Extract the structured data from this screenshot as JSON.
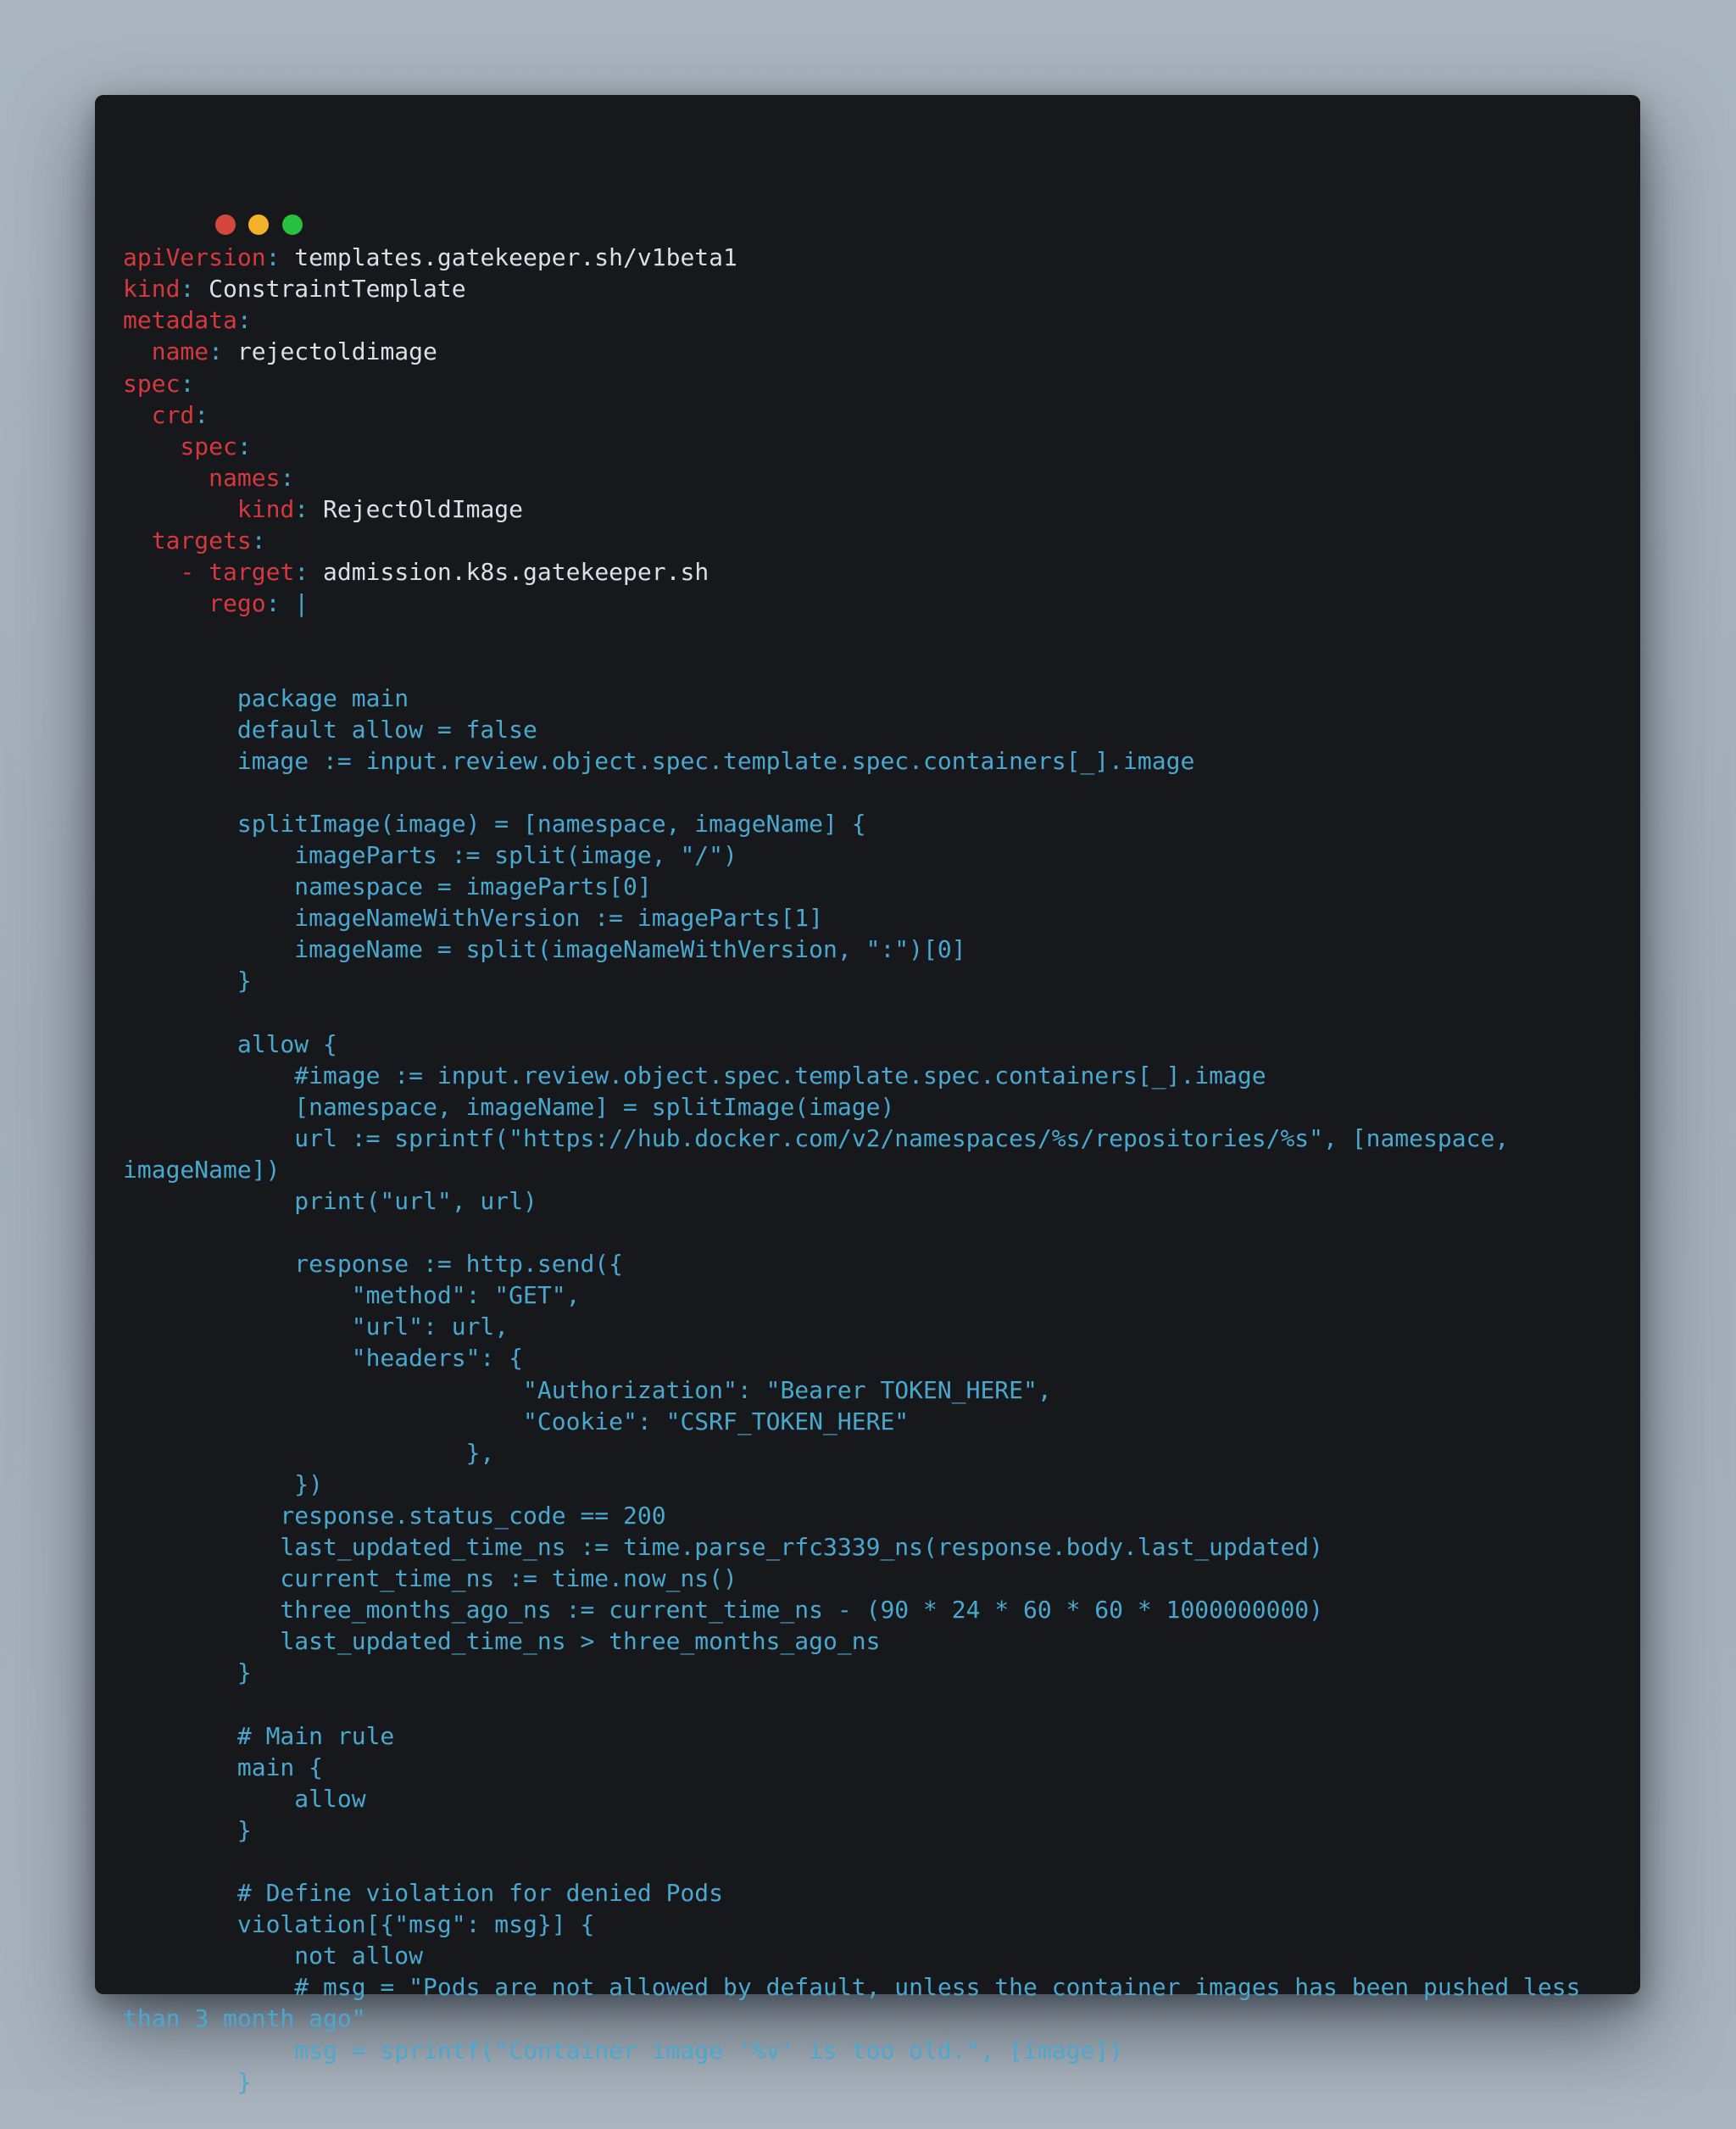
{
  "window": {
    "controls": [
      "close",
      "minimize",
      "maximize"
    ],
    "colors": {
      "close": "#d4473d",
      "minimize": "#f4b12a",
      "maximize": "#27c13f",
      "background": "#17181b",
      "key": "#d5393f",
      "value": "#dcdfe3",
      "code": "#4aa8cf"
    }
  },
  "yaml": [
    {
      "indent": "",
      "key": "apiVersion",
      "value": "templates.gatekeeper.sh/v1beta1"
    },
    {
      "indent": "",
      "key": "kind",
      "value": "ConstraintTemplate"
    },
    {
      "indent": "",
      "key": "metadata",
      "value": ""
    },
    {
      "indent": "  ",
      "key": "name",
      "value": "rejectoldimage"
    },
    {
      "indent": "",
      "key": "spec",
      "value": ""
    },
    {
      "indent": "  ",
      "key": "crd",
      "value": ""
    },
    {
      "indent": "    ",
      "key": "spec",
      "value": ""
    },
    {
      "indent": "      ",
      "key": "names",
      "value": ""
    },
    {
      "indent": "        ",
      "key": "kind",
      "value": "RejectOldImage"
    },
    {
      "indent": "  ",
      "key": "targets",
      "value": ""
    },
    {
      "indent": "    - ",
      "key": "target",
      "value": "admission.k8s.gatekeeper.sh"
    },
    {
      "indent": "      ",
      "key": "rego",
      "value": "|"
    }
  ],
  "rego": [
    "        package main",
    "        default allow = false",
    "        image := input.review.object.spec.template.spec.containers[_].image",
    "",
    "        splitImage(image) = [namespace, imageName] {",
    "            imageParts := split(image, \"/\")",
    "            namespace = imageParts[0]",
    "            imageNameWithVersion := imageParts[1]",
    "            imageName = split(imageNameWithVersion, \":\")[0]",
    "        }",
    "",
    "        allow {",
    "            #image := input.review.object.spec.template.spec.containers[_].image",
    "            [namespace, imageName] = splitImage(image)",
    "            url := sprintf(\"https://hub.docker.com/v2/namespaces/%s/repositories/%s\", [namespace,",
    "imageName])",
    "            print(\"url\", url)",
    "",
    "            response := http.send({",
    "                \"method\": \"GET\",",
    "                \"url\": url,",
    "                \"headers\": {",
    "                            \"Authorization\": \"Bearer TOKEN_HERE\",",
    "                            \"Cookie\": \"CSRF_TOKEN_HERE\"",
    "                        },",
    "            })",
    "           response.status_code == 200",
    "           last_updated_time_ns := time.parse_rfc3339_ns(response.body.last_updated)",
    "           current_time_ns := time.now_ns()",
    "           three_months_ago_ns := current_time_ns - (90 * 24 * 60 * 60 * 1000000000)",
    "           last_updated_time_ns > three_months_ago_ns",
    "        }",
    "",
    "        # Main rule",
    "        main {",
    "            allow",
    "        }",
    "",
    "        # Define violation for denied Pods",
    "        violation[{\"msg\": msg}] {",
    "            not allow",
    "            # msg = \"Pods are not allowed by default, unless the container images has been pushed less",
    "than 3 month ago\"",
    "            msg = sprintf(\"Container image '%v' is too old.\", [image])",
    "        }"
  ]
}
